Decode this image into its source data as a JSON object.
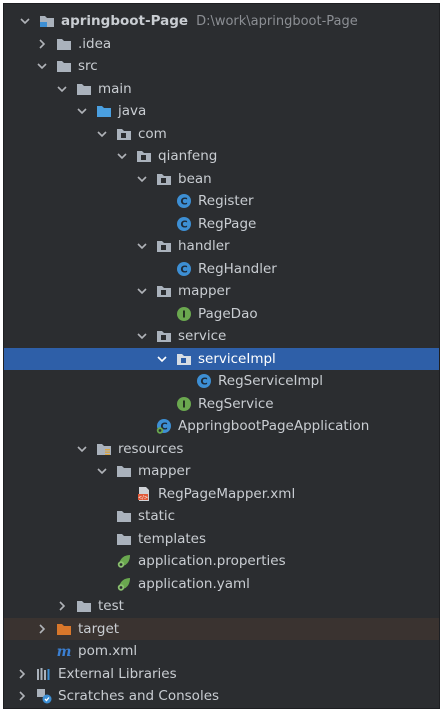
{
  "project": {
    "name": "apringboot-Page",
    "path": "D:\\work\\apringboot-Page"
  },
  "tree": {
    "idea": ".idea",
    "src": "src",
    "main": "main",
    "java": "java",
    "com": "com",
    "qianfeng": "qianfeng",
    "bean": "bean",
    "register": "Register",
    "regpage": "RegPage",
    "handler": "handler",
    "reghandler": "RegHandler",
    "mapper": "mapper",
    "pagedao": "PageDao",
    "service": "service",
    "serviceimpl": "serviceImpl",
    "regserviceimpl": "RegServiceImpl",
    "regservice": "RegService",
    "app": "AppringbootPageApplication",
    "resources": "resources",
    "res_mapper": "mapper",
    "mapperxml": "RegPageMapper.xml",
    "static": "static",
    "templates": "templates",
    "props": "application.properties",
    "yaml": "application.yaml",
    "test": "test",
    "target": "target",
    "pom": "pom.xml",
    "extlibs": "External Libraries",
    "scratches": "Scratches and Consoles"
  },
  "colors": {
    "background": "#2b2d30",
    "selection": "#2e5fa8",
    "class_icon": "#3d8fd4",
    "interface_icon": "#6aa84f",
    "folder": "#aab2bc",
    "source_folder": "#4a9fe0",
    "excluded_folder": "#d9772b",
    "maven": "#3b7fd1"
  }
}
